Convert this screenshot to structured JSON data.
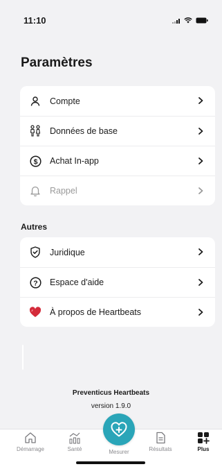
{
  "status_bar": {
    "time": "11:10"
  },
  "page_title": "Paramètres",
  "settings_items": [
    {
      "label": "Compte",
      "icon": "user-icon"
    },
    {
      "label": "Données de base",
      "icon": "people-icon"
    },
    {
      "label": "Achat In-app",
      "icon": "dollar-circle-icon"
    },
    {
      "label": "Rappel",
      "icon": "bell-icon"
    }
  ],
  "others_section": {
    "title": "Autres",
    "items": [
      {
        "label": "Juridique",
        "icon": "shield-check-icon"
      },
      {
        "label": "Espace d'aide",
        "icon": "help-circle-icon"
      },
      {
        "label": "À propos de Heartbeats",
        "icon": "heart-icon"
      }
    ]
  },
  "footer": {
    "app_name": "Preventicus Heartbeats",
    "version": "version 1.9.0"
  },
  "tabbar": {
    "tabs": [
      {
        "label": "Démarrage",
        "icon": "home-icon"
      },
      {
        "label": "Santé",
        "icon": "chart-icon"
      },
      {
        "label": "Mesurer",
        "icon": "heart-plus-icon"
      },
      {
        "label": "Résultats",
        "icon": "document-icon"
      },
      {
        "label": "Plus",
        "icon": "grid-plus-icon"
      }
    ],
    "active_tab": "Plus"
  },
  "colors": {
    "accent": "#2aa5b8",
    "heart_red": "#d42b3a",
    "background": "#f2f2f4"
  }
}
